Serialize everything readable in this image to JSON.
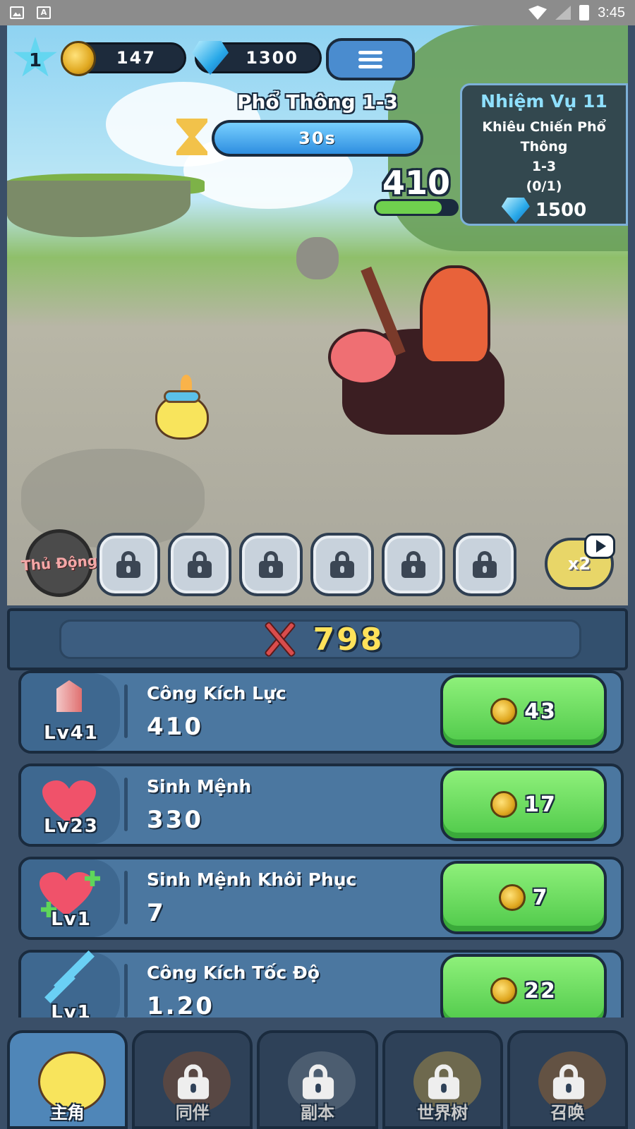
{
  "status_bar": {
    "time": "3:45"
  },
  "hud": {
    "player_level": "1",
    "coins": "147",
    "gems": "1300"
  },
  "stage": {
    "title": "Phổ Thông 1-3",
    "timer": "30s",
    "enemy_power": "410",
    "enemy_hp_fraction": 0.82
  },
  "quest": {
    "title": "Nhiệm Vụ 11",
    "desc_line1": "Khiêu Chiến Phổ Thông",
    "desc_line2": "1-3",
    "progress": "(0/1)",
    "reward": "1500"
  },
  "skills": {
    "auto_label": "Thủ Động",
    "slots": [
      "locked",
      "locked",
      "locked",
      "locked",
      "locked",
      "locked"
    ],
    "speed_label": "x2"
  },
  "power": {
    "value": "798"
  },
  "upgrades": [
    {
      "name": "Công Kích Lực",
      "value": "410",
      "level": "Lv41",
      "cost": "43",
      "icon": "sword-icon"
    },
    {
      "name": "Sinh Mệnh",
      "value": "330",
      "level": "Lv23",
      "cost": "17",
      "icon": "heart-icon"
    },
    {
      "name": "Sinh Mệnh Khôi Phục",
      "value": "7",
      "level": "Lv1",
      "cost": "7",
      "icon": "heart-regen-icon"
    },
    {
      "name": "Công Kích Tốc Độ",
      "value": "1.20",
      "level": "Lv1",
      "cost": "22",
      "icon": "arrows-icon"
    }
  ],
  "tabs": [
    {
      "label": "主角",
      "locked": false
    },
    {
      "label": "同伴",
      "locked": true
    },
    {
      "label": "副本",
      "locked": true
    },
    {
      "label": "世界树",
      "locked": true
    },
    {
      "label": "召唤",
      "locked": true
    }
  ],
  "colors": {
    "accent_green": "#4fc94a",
    "panel_blue": "#4b77a0",
    "dark_outline": "#1a2b3e",
    "gold_text": "#ffe25a",
    "quest_title": "#8fe0ff"
  }
}
